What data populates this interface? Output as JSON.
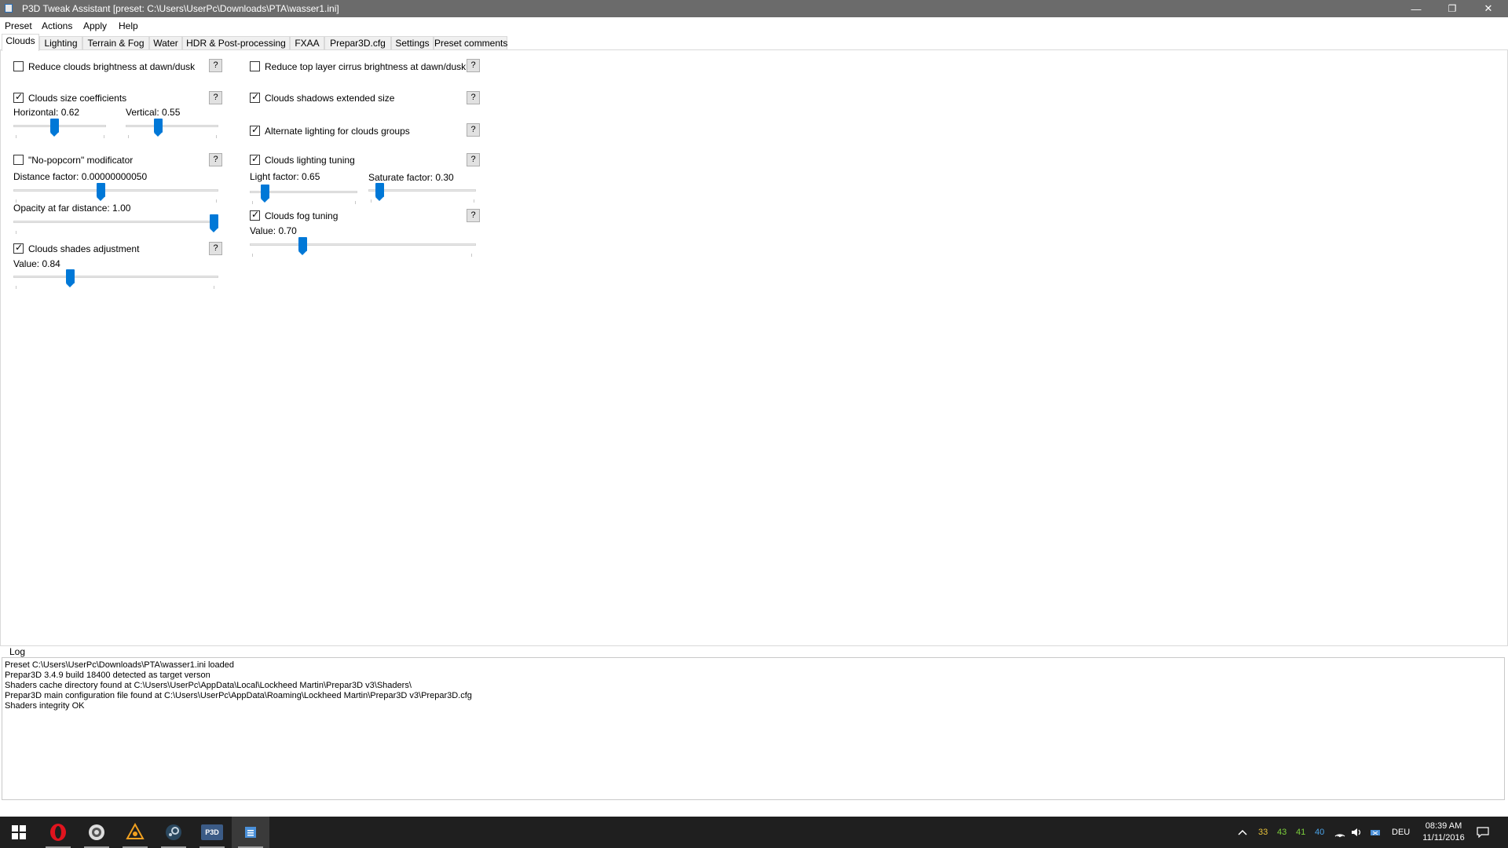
{
  "window": {
    "title": "P3D Tweak Assistant [preset: C:\\Users\\UserPc\\Downloads\\PTA\\wasser1.ini]",
    "minimize": "—",
    "restore": "❐",
    "close": "✕"
  },
  "menu": [
    "Preset",
    "Actions",
    "Apply",
    "Help"
  ],
  "tabs": [
    "Clouds",
    "Lighting",
    "Terrain & Fog",
    "Water",
    "HDR & Post-processing",
    "FXAA",
    "Prepar3D.cfg",
    "Settings",
    "Preset comments"
  ],
  "active_tab": "Clouds",
  "help_label": "?",
  "clouds": {
    "reduce_brightness": {
      "label": "Reduce clouds brightness at dawn/dusk",
      "checked": false
    },
    "size_coefficients": {
      "label": "Clouds size coefficients",
      "checked": true,
      "horizontal_label": "Horizontal: 0.62",
      "horizontal_value": 0.62,
      "vertical_label": "Vertical: 0.55",
      "vertical_value": 0.55
    },
    "no_popcorn": {
      "label": "\"No-popcorn\" modificator",
      "checked": false,
      "distance_label": "Distance factor: 0.00000000050",
      "opacity_label": "Opacity at far distance: 1.00",
      "opacity_value": 1.0
    },
    "shades": {
      "label": "Clouds shades adjustment",
      "checked": true,
      "value_label": "Value: 0.84",
      "value": 0.84
    },
    "cirrus": {
      "label": "Reduce top layer cirrus brightness at dawn/dusk",
      "checked": false
    },
    "shadows": {
      "label": "Clouds shadows extended size",
      "checked": true
    },
    "alt_lighting": {
      "label": "Alternate lighting for clouds groups",
      "checked": true
    },
    "lighting_tuning": {
      "label": "Clouds lighting tuning",
      "checked": true,
      "light_label": "Light factor: 0.65",
      "light_value": 0.65,
      "saturate_label": "Saturate factor: 0.30",
      "saturate_value": 0.3
    },
    "fog_tuning": {
      "label": "Clouds fog tuning",
      "checked": true,
      "value_label": "Value: 0.70",
      "value": 0.7
    }
  },
  "log": {
    "label": "Log",
    "lines": [
      "Preset C:\\Users\\UserPc\\Downloads\\PTA\\wasser1.ini loaded",
      "Prepar3D 3.4.9 build 18400 detected as target verson",
      "Shaders cache directory found at C:\\Users\\UserPc\\AppData\\Local\\Lockheed Martin\\Prepar3D v3\\Shaders\\",
      "Prepar3D main configuration file found at C:\\Users\\UserPc\\AppData\\Roaming\\Lockheed Martin\\Prepar3D v3\\Prepar3D.cfg",
      "Shaders integrity OK"
    ]
  },
  "taskbar": {
    "apps": [
      "windows-start-icon",
      "opera-icon",
      "settings-app-icon",
      "cube-app-icon",
      "steam-icon",
      "p3d-icon",
      "tweak-assistant-icon"
    ],
    "p3d_label": "P3D",
    "tray_temps": [
      "33",
      "43",
      "41",
      "40"
    ],
    "tray_colors": [
      "#e8c23a",
      "#7ccf3c",
      "#7ccf3c",
      "#4aa3e8"
    ],
    "language": "DEU",
    "time": "08:39 AM",
    "date": "11/11/2016"
  }
}
